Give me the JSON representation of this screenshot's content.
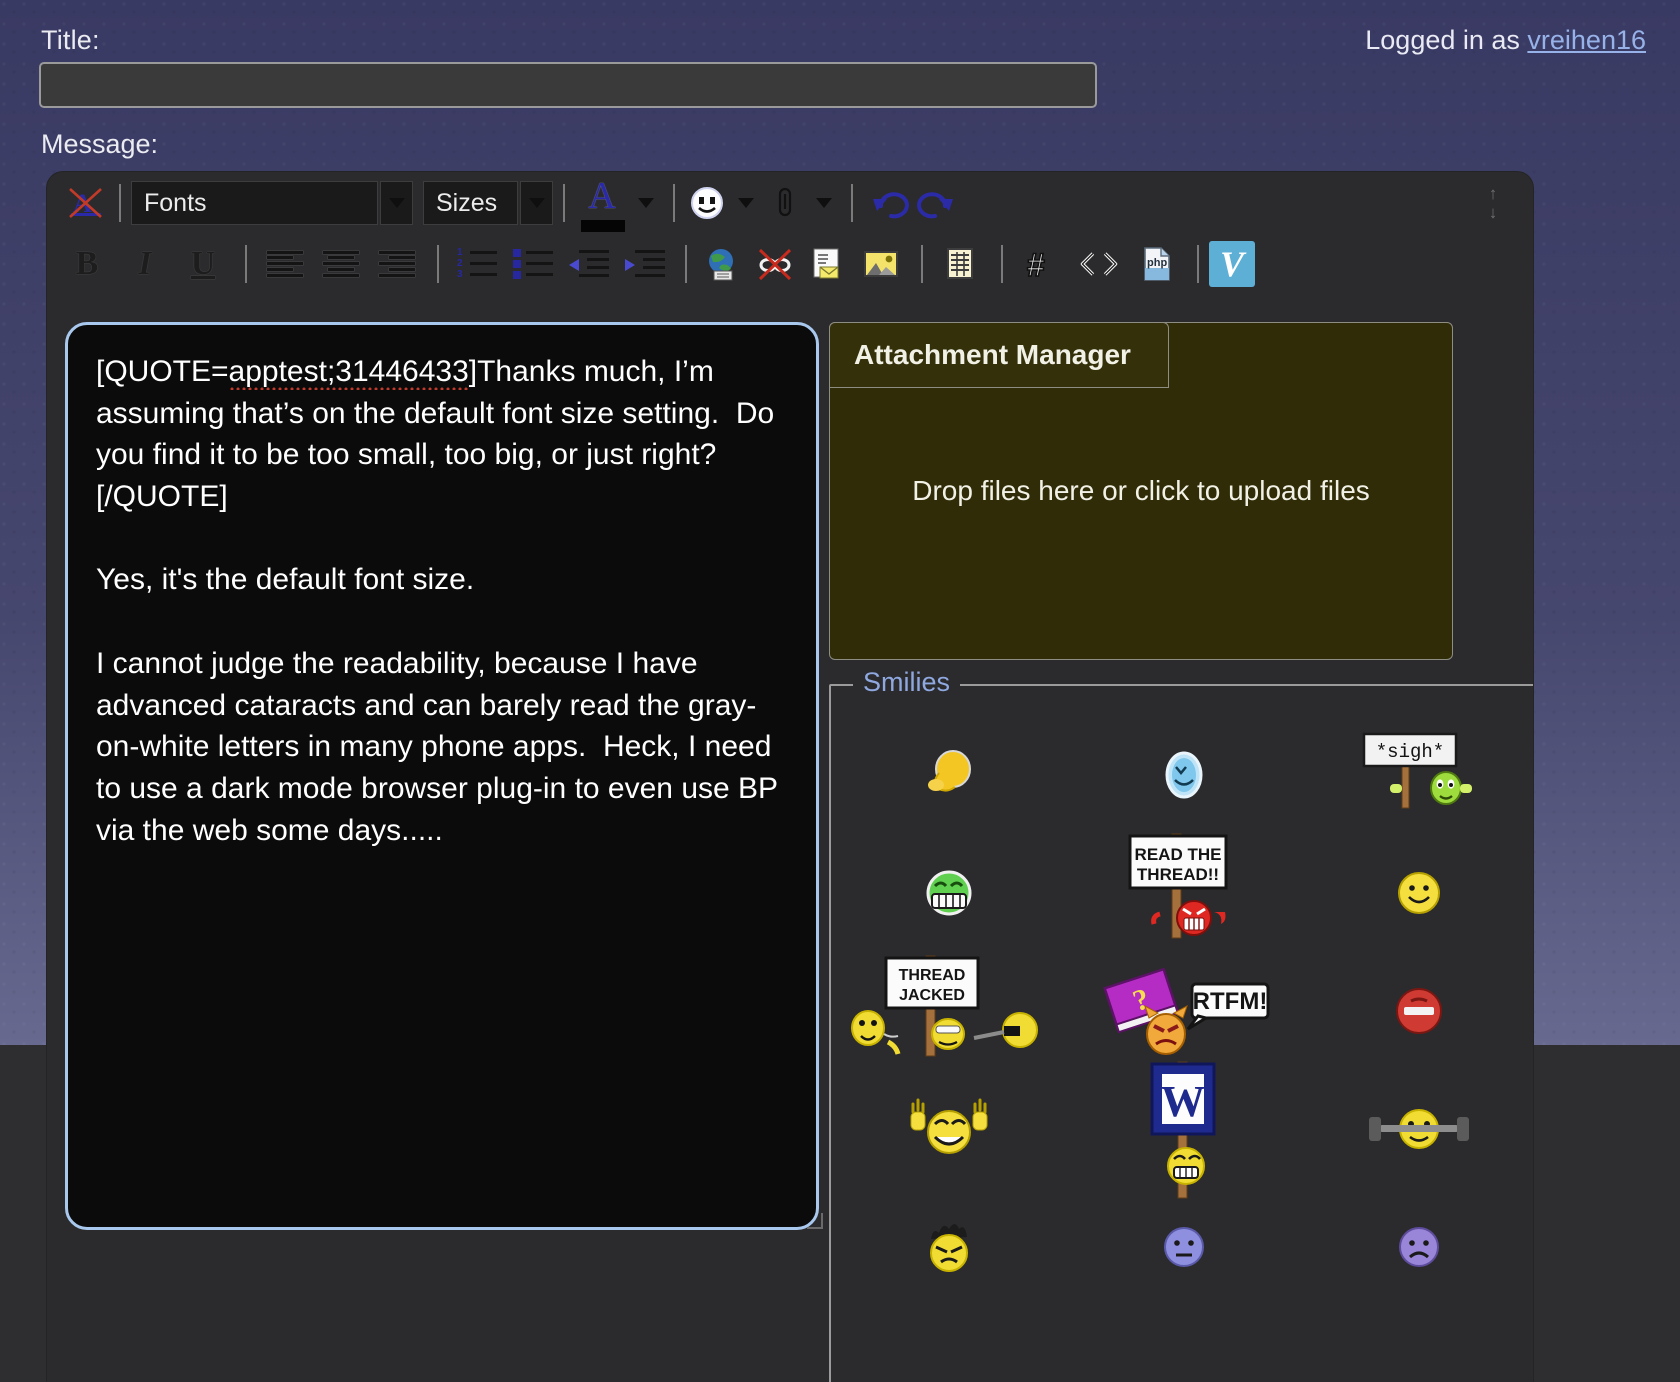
{
  "header": {
    "title_label": "Title:",
    "title_value": "",
    "title_placeholder": "",
    "logged_in_prefix": "Logged in as ",
    "username": "vreihen16",
    "message_label": "Message:"
  },
  "toolbar": {
    "row1": [
      {
        "name": "remove-formatting-icon",
        "label": "Remove Formatting"
      },
      {
        "name": "font-family-select",
        "label": "Fonts"
      },
      {
        "name": "font-size-select",
        "label": "Sizes"
      },
      {
        "name": "font-color-icon",
        "label": "A",
        "color": "#050505"
      },
      {
        "name": "smiley-insert-icon",
        "label": "Smilie"
      },
      {
        "name": "attachment-icon",
        "label": "Attachment"
      },
      {
        "name": "undo-icon",
        "label": "Undo"
      },
      {
        "name": "redo-icon",
        "label": "Redo"
      }
    ],
    "row2": [
      {
        "name": "bold-button",
        "label": "B"
      },
      {
        "name": "italic-button",
        "label": "I"
      },
      {
        "name": "underline-button",
        "label": "U"
      },
      {
        "name": "align-left-icon",
        "label": "Align Left"
      },
      {
        "name": "align-center-icon",
        "label": "Align Center"
      },
      {
        "name": "align-right-icon",
        "label": "Align Right"
      },
      {
        "name": "ordered-list-icon",
        "label": "Ordered List"
      },
      {
        "name": "unordered-list-icon",
        "label": "Unordered List"
      },
      {
        "name": "outdent-icon",
        "label": "Outdent"
      },
      {
        "name": "indent-icon",
        "label": "Indent"
      },
      {
        "name": "insert-link-icon",
        "label": "Insert Link"
      },
      {
        "name": "remove-link-icon",
        "label": "Remove Link"
      },
      {
        "name": "insert-email-icon",
        "label": "Insert Email"
      },
      {
        "name": "insert-image-icon",
        "label": "Insert Image"
      },
      {
        "name": "insert-table-icon",
        "label": "Insert Table"
      },
      {
        "name": "insert-hash-icon",
        "label": "Insert Hash"
      },
      {
        "name": "insert-code-icon",
        "label": "Insert Code"
      },
      {
        "name": "insert-php-icon",
        "label": "Insert PHP"
      },
      {
        "name": "insert-vimeo-icon",
        "label": "V"
      }
    ],
    "resize": {
      "up": "↑",
      "down": "↓"
    }
  },
  "message": {
    "quote_open": "[QUOTE=",
    "quote_author_id": "apptest;31446433",
    "quote_open_end": "]Thanks much, I’m assuming that’s on the default font size setting.  Do you find it to be too small, too big, or just right?[/QUOTE]",
    "body": "\n\nYes, it's the default font size.\n\nI cannot judge the readability, because I have advanced cataracts and can barely read the gray-on-white letters in many phone apps.  Heck, I need to use a dark mode browser plug-in to even use BP via the web some days....."
  },
  "attachment": {
    "tab_label": "Attachment Manager",
    "drop_text": "Drop files here or click to upload files"
  },
  "smilies": {
    "legend": "Smilies",
    "items": [
      {
        "name": "smilie-facepalm",
        "alt": "facepalm"
      },
      {
        "name": "smilie-blue-smile",
        "alt": "blue smile"
      },
      {
        "name": "smilie-sigh-sign",
        "alt": "*sigh* sign"
      },
      {
        "name": "smilie-green-grin",
        "alt": "green grin"
      },
      {
        "name": "smilie-read-the-thread",
        "alt": "READ THE THREAD!!"
      },
      {
        "name": "smilie-yellow-smile",
        "alt": "yellow smile"
      },
      {
        "name": "smilie-thread-jacked",
        "alt": "THREAD JACKED"
      },
      {
        "name": "smilie-rtfm",
        "alt": "RTFM!"
      },
      {
        "name": "smilie-stop-sign",
        "alt": "stop"
      },
      {
        "name": "smilie-cheer",
        "alt": "cheering"
      },
      {
        "name": "smilie-w-sign",
        "alt": "W sign"
      },
      {
        "name": "smilie-dumbbell",
        "alt": "workout"
      },
      {
        "name": "smilie-angry-hair",
        "alt": "angry"
      },
      {
        "name": "smilie-blue-neutral",
        "alt": "neutral"
      },
      {
        "name": "smilie-purple-sad",
        "alt": "sad"
      }
    ],
    "sign_texts": {
      "sigh": "*sigh*",
      "read_the_thread_l1": "READ THE",
      "read_the_thread_l2": "THREAD!!",
      "thread_jacked_l1": "THREAD",
      "thread_jacked_l2": "JACKED",
      "rtfm": "RTFM!",
      "w": "W"
    }
  },
  "colors": {
    "page_bg": "#3b3c65",
    "editor_bg": "#2b2b2d",
    "textarea_bg": "#0b0b0b",
    "textarea_border": "#a9c8ee",
    "attachment_bg": "#33300a",
    "link": "#97b2e8",
    "legend": "#8fa8e0",
    "vimeo": "#5eafd6"
  }
}
